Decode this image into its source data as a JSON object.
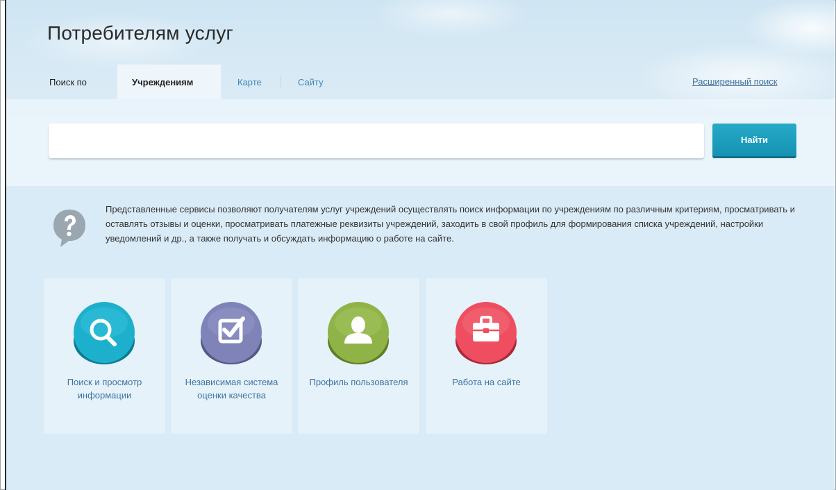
{
  "header": {
    "title": "Потребителям услуг",
    "search_by_label": "Поиск по",
    "tabs": [
      {
        "label": "Учреждениям",
        "active": true
      },
      {
        "label": "Карте",
        "active": false
      },
      {
        "label": "Сайту",
        "active": false
      }
    ],
    "advanced_search_label": "Расширенный поиск"
  },
  "search": {
    "input_value": "",
    "placeholder": "",
    "button_label": "Найти"
  },
  "info": {
    "icon": "question-bubble-icon",
    "text": "Представленные сервисы позволяют получателям услуг учреждений осуществлять поиск информации по учреждениям по различным критериям, просматривать и оставлять отзывы и оценки, просматривать платежные реквизиты учреждений, заходить в свой профиль для формирования списка учреждений, настройки уведомлений и др., а также получать и обсуждать информацию о работе на сайте."
  },
  "cards": [
    {
      "label": "Поиск и просмотр информации",
      "icon": "search-icon",
      "color": "#19a8c4"
    },
    {
      "label": "Независимая система оценки качества",
      "icon": "checkbox-icon",
      "color": "#7b7fb5"
    },
    {
      "label": "Профиль пользователя",
      "icon": "user-icon",
      "color": "#8cb044"
    },
    {
      "label": "Работа на сайте",
      "icon": "briefcase-icon",
      "color": "#ea4a5c"
    }
  ],
  "colors": {
    "accent": "#1a9fc0",
    "link": "#3f74a1",
    "background": "#d9ebf6"
  }
}
